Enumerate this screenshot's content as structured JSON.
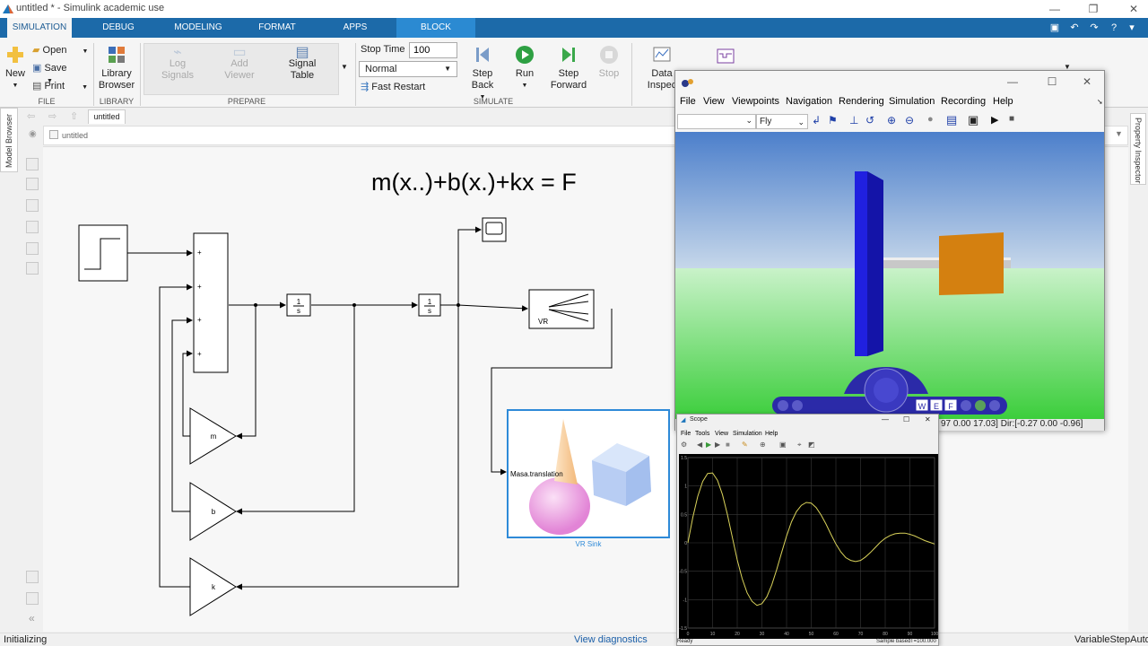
{
  "window": {
    "title": "untitled * - Simulink academic use"
  },
  "tabs": [
    {
      "label": "SIMULATION"
    },
    {
      "label": "DEBUG"
    },
    {
      "label": "MODELING"
    },
    {
      "label": "FORMAT"
    },
    {
      "label": "APPS"
    },
    {
      "label": "BLOCK"
    }
  ],
  "toolstrip": {
    "new": "New",
    "open": "Open",
    "save": "Save",
    "print": "Print",
    "file_group": "FILE",
    "library_browser_line1": "Library",
    "library_browser_line2": "Browser",
    "library_group": "LIBRARY",
    "log_signals_line1": "Log",
    "log_signals_line2": "Signals",
    "add_viewer_line1": "Add",
    "add_viewer_line2": "Viewer",
    "signal_table_line1": "Signal",
    "signal_table_line2": "Table",
    "prepare_group": "PREPARE",
    "stop_time_label": "Stop Time",
    "stop_time_value": "100",
    "sim_mode": "Normal",
    "fast_restart": "Fast Restart",
    "step_back_line1": "Step",
    "step_back_line2": "Back",
    "run": "Run",
    "step_forward_line1": "Step",
    "step_forward_line2": "Forward",
    "stop": "Stop",
    "simulate_group": "SIMULATE",
    "data_inspector_line1": "Data",
    "data_inspector_line2": "Inspec"
  },
  "editor": {
    "model_tab": "untitled",
    "breadcrumb": "untitled",
    "model_browser": "Model Browser",
    "property_inspector": "Property Inspector"
  },
  "diagram": {
    "equation": "m(x..)+b(x.)+kx = F",
    "integrator_num": "1",
    "integrator_den": "s",
    "gain_m": "m",
    "gain_b": "b",
    "gain_k": "k",
    "sum_signs": [
      "+",
      "+",
      "+",
      "+"
    ],
    "vr_label": "VR",
    "vr_sink_input": "Masa.translation",
    "vr_sink_name": "VR Sink"
  },
  "status": {
    "left": "Initializing",
    "center": "View diagnostics",
    "right": "VariableStepAuto"
  },
  "vr_window": {
    "menu": [
      "File",
      "View",
      "Viewpoints",
      "Navigation",
      "Rendering",
      "Simulation",
      "Recording",
      "Help"
    ],
    "nav_mode": "Fly",
    "status_text": "97 0.00 17.03] Dir:[-0.27 0.00 -0.96]",
    "nav_buttons": [
      "W",
      "E",
      "F"
    ]
  },
  "scope": {
    "title": "Scope",
    "menu": [
      "File",
      "Tools",
      "View",
      "Simulation",
      "Help"
    ],
    "status_left": "Ready",
    "status_mid": "Sample based",
    "status_right": "T=100.000"
  },
  "chart_data": {
    "type": "line",
    "title": "",
    "xlabel": "",
    "ylabel": "",
    "xlim": [
      0,
      100
    ],
    "ylim": [
      -1.5,
      1.5
    ],
    "xticks": [
      "0",
      "10",
      "20",
      "30",
      "40",
      "50",
      "60",
      "70",
      "80",
      "90",
      "100"
    ],
    "yticks": [
      "1.5",
      "1",
      "0.5",
      "0",
      "-0.5",
      "-1",
      "-1.5"
    ],
    "grid": true,
    "series": [
      {
        "color": "#d9d25a",
        "x": [
          0,
          2,
          4,
          6,
          8,
          10,
          12,
          14,
          16,
          18,
          20,
          22,
          24,
          26,
          28,
          30,
          32,
          34,
          36,
          38,
          40,
          42,
          44,
          46,
          48,
          50,
          52,
          54,
          56,
          58,
          60,
          62,
          64,
          66,
          68,
          70,
          72,
          74,
          76,
          78,
          80,
          82,
          84,
          86,
          88,
          90,
          92,
          94,
          96,
          98,
          100
        ],
        "y": [
          0,
          0.45,
          0.82,
          1.08,
          1.22,
          1.23,
          1.1,
          0.85,
          0.5,
          0.1,
          -0.3,
          -0.63,
          -0.88,
          -1.03,
          -1.1,
          -1.07,
          -0.95,
          -0.74,
          -0.47,
          -0.17,
          0.12,
          0.37,
          0.55,
          0.66,
          0.71,
          0.7,
          0.62,
          0.49,
          0.33,
          0.15,
          -0.02,
          -0.16,
          -0.26,
          -0.31,
          -0.33,
          -0.31,
          -0.25,
          -0.17,
          -0.08,
          0.01,
          0.08,
          0.13,
          0.16,
          0.17,
          0.17,
          0.15,
          0.12,
          0.08,
          0.04,
          0.01,
          -0.02
        ]
      }
    ]
  }
}
